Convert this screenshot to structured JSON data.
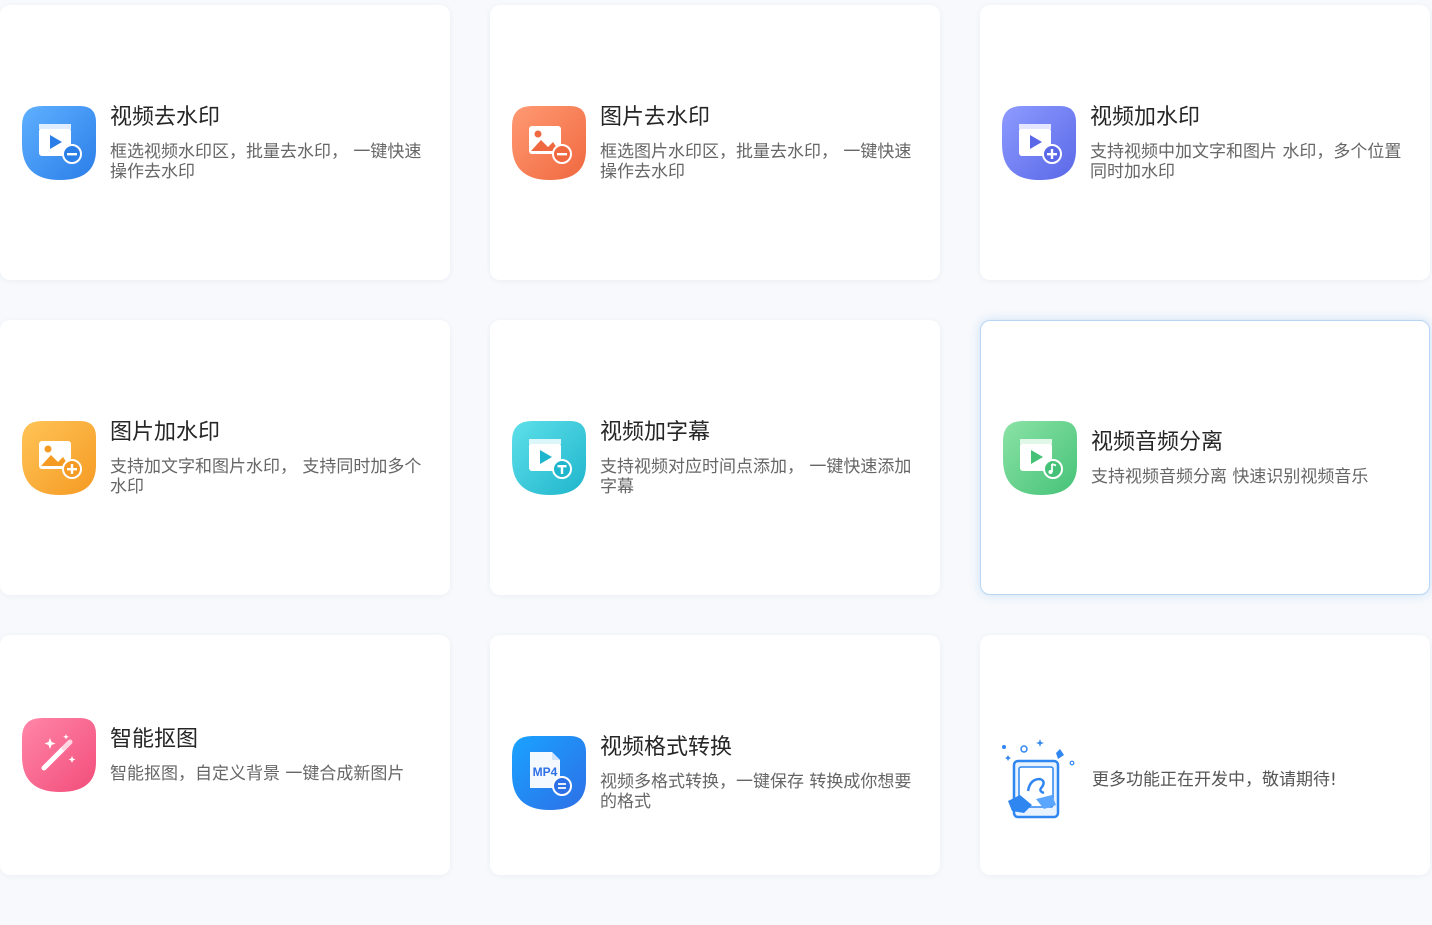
{
  "colors": {
    "background": "#f7f9fc",
    "card": "#ffffff",
    "title": "#262626",
    "desc": "#666666",
    "highlight_border": "#b9d7f5"
  },
  "cards": [
    {
      "title": "视频去水印",
      "desc": "框选视频水印区，批量去水印， 一键快速操作去水印",
      "icon": "video-remove-watermark-icon",
      "icon_color": "#3b8ff0"
    },
    {
      "title": "图片去水印",
      "desc": "框选图片水印区，批量去水印， 一键快速操作去水印",
      "icon": "image-remove-watermark-icon",
      "icon_color": "#f57e5a"
    },
    {
      "title": "视频加水印",
      "desc": "支持视频中加文字和图片 水印，多个位置同时加水印",
      "icon": "video-add-watermark-icon",
      "icon_color": "#6d7cf0"
    },
    {
      "title": "图片加水印",
      "desc": "支持加文字和图片水印， 支持同时加多个水印",
      "icon": "image-add-watermark-icon",
      "icon_color": "#f7a73a"
    },
    {
      "title": "视频加字幕",
      "desc": "支持视频对应时间点添加， 一键快速添加字幕",
      "icon": "video-subtitle-icon",
      "icon_color": "#32c6d8"
    },
    {
      "title": "视频音频分离",
      "desc": "支持视频音频分离 快速识别视频音乐",
      "icon": "video-audio-separate-icon",
      "icon_color": "#5cd08a"
    },
    {
      "title": "智能抠图",
      "desc": "智能抠图，自定义背景 一键合成新图片",
      "icon": "magic-wand-icon",
      "icon_color": "#f5577f"
    },
    {
      "title": "视频格式转换",
      "desc": "视频多格式转换，一键保存 转换成你想要的格式",
      "icon": "mp4-convert-icon",
      "icon_color": "#1e8ff0",
      "icon_text": "MP4"
    },
    {
      "title": "",
      "desc": "更多功能正在开发中，敬请期待!",
      "icon": "developing-illustration-icon",
      "icon_color": "#2f86f0"
    }
  ]
}
